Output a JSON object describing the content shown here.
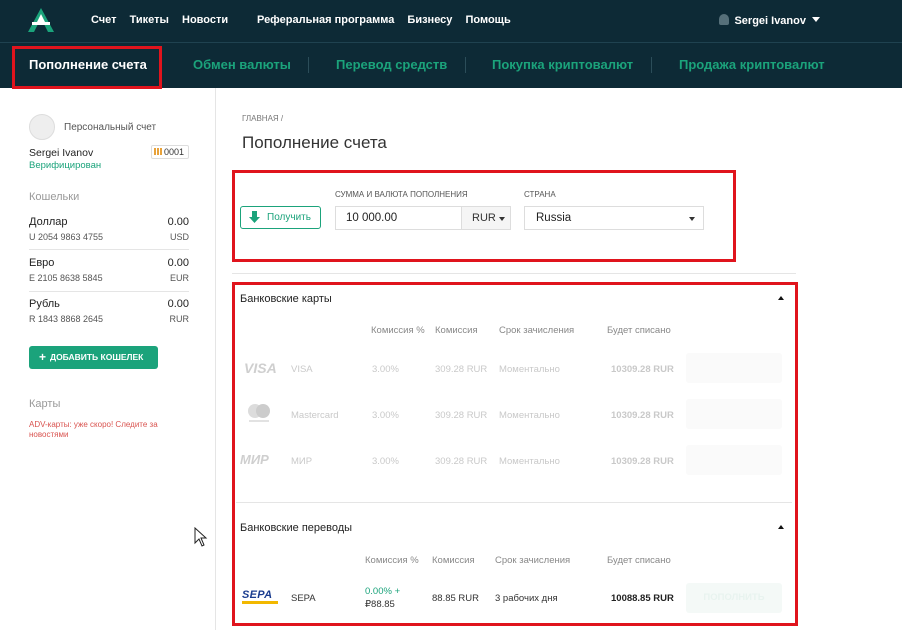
{
  "header": {
    "nav": [
      "Счет",
      "Тикеты",
      "Новости"
    ],
    "nav2": [
      "Реферальная программа",
      "Бизнесу",
      "Помощь"
    ],
    "user": "Sergei Ivanov"
  },
  "tabs": [
    "Пополнение счета",
    "Обмен валюты",
    "Перевод средств",
    "Покупка криптовалют",
    "Продажа криптовалют"
  ],
  "sidebar": {
    "account_label": "Персональный счет",
    "name": "Sergei Ivanov",
    "status": "Верифицирован",
    "badge": "0001",
    "wallets_heading": "Кошельки",
    "wallets": [
      {
        "name": "Доллар",
        "balance": "0.00",
        "account": "U 2054 9863 4755",
        "currency": "USD"
      },
      {
        "name": "Евро",
        "balance": "0.00",
        "account": "E 2105 8638 5845",
        "currency": "EUR"
      },
      {
        "name": "Рубль",
        "balance": "0.00",
        "account": "R 1843 8868 2645",
        "currency": "RUR"
      }
    ],
    "add_wallet": "ДОБАВИТЬ КОШЕЛЕК",
    "cards_heading": "Карты",
    "cards_note": "ADV-карты: уже скоро! Следите за новостями"
  },
  "main": {
    "breadcrumb": "ГЛАВНАЯ /",
    "title": "Пополнение счета",
    "receive_button": "Получить",
    "amount_label": "СУММА И ВАЛЮТА ПОПОЛНЕНИЯ",
    "amount_value": "10 000.00",
    "currency": "RUR",
    "country_label": "СТРАНА",
    "country": "Russia"
  },
  "bank_cards": {
    "title": "Банковские карты",
    "columns": [
      "Комиссия %",
      "Комиссия",
      "Срок зачисления",
      "Будет списано"
    ],
    "rows": [
      {
        "logo": "VISA",
        "name": "VISA",
        "percent": "3.00%",
        "fee": "309.28 RUR",
        "term": "Моментально",
        "total": "10309.28 RUR"
      },
      {
        "logo": "",
        "name": "Mastercard",
        "percent": "3.00%",
        "fee": "309.28 RUR",
        "term": "Моментально",
        "total": "10309.28 RUR"
      },
      {
        "logo": "МИР",
        "name": "МИР",
        "percent": "3.00%",
        "fee": "309.28 RUR",
        "term": "Моментально",
        "total": "10309.28 RUR"
      }
    ]
  },
  "bank_transfers": {
    "title": "Банковские переводы",
    "columns": [
      "Комиссия %",
      "Комиссия",
      "Срок зачисления",
      "Будет списано"
    ],
    "rows": [
      {
        "logo": "SEPA",
        "name": "SEPA",
        "percent": "0.00% +",
        "percent_extra": "₽88.85",
        "fee": "88.85 RUR",
        "term": "3 рабочих дня",
        "total": "10088.85 RUR",
        "action": "ПОПОЛНИТЬ"
      }
    ]
  },
  "colors": {
    "header_bg": "#0d2a36",
    "accent": "#1ba37b",
    "highlight": "#e0141d"
  }
}
